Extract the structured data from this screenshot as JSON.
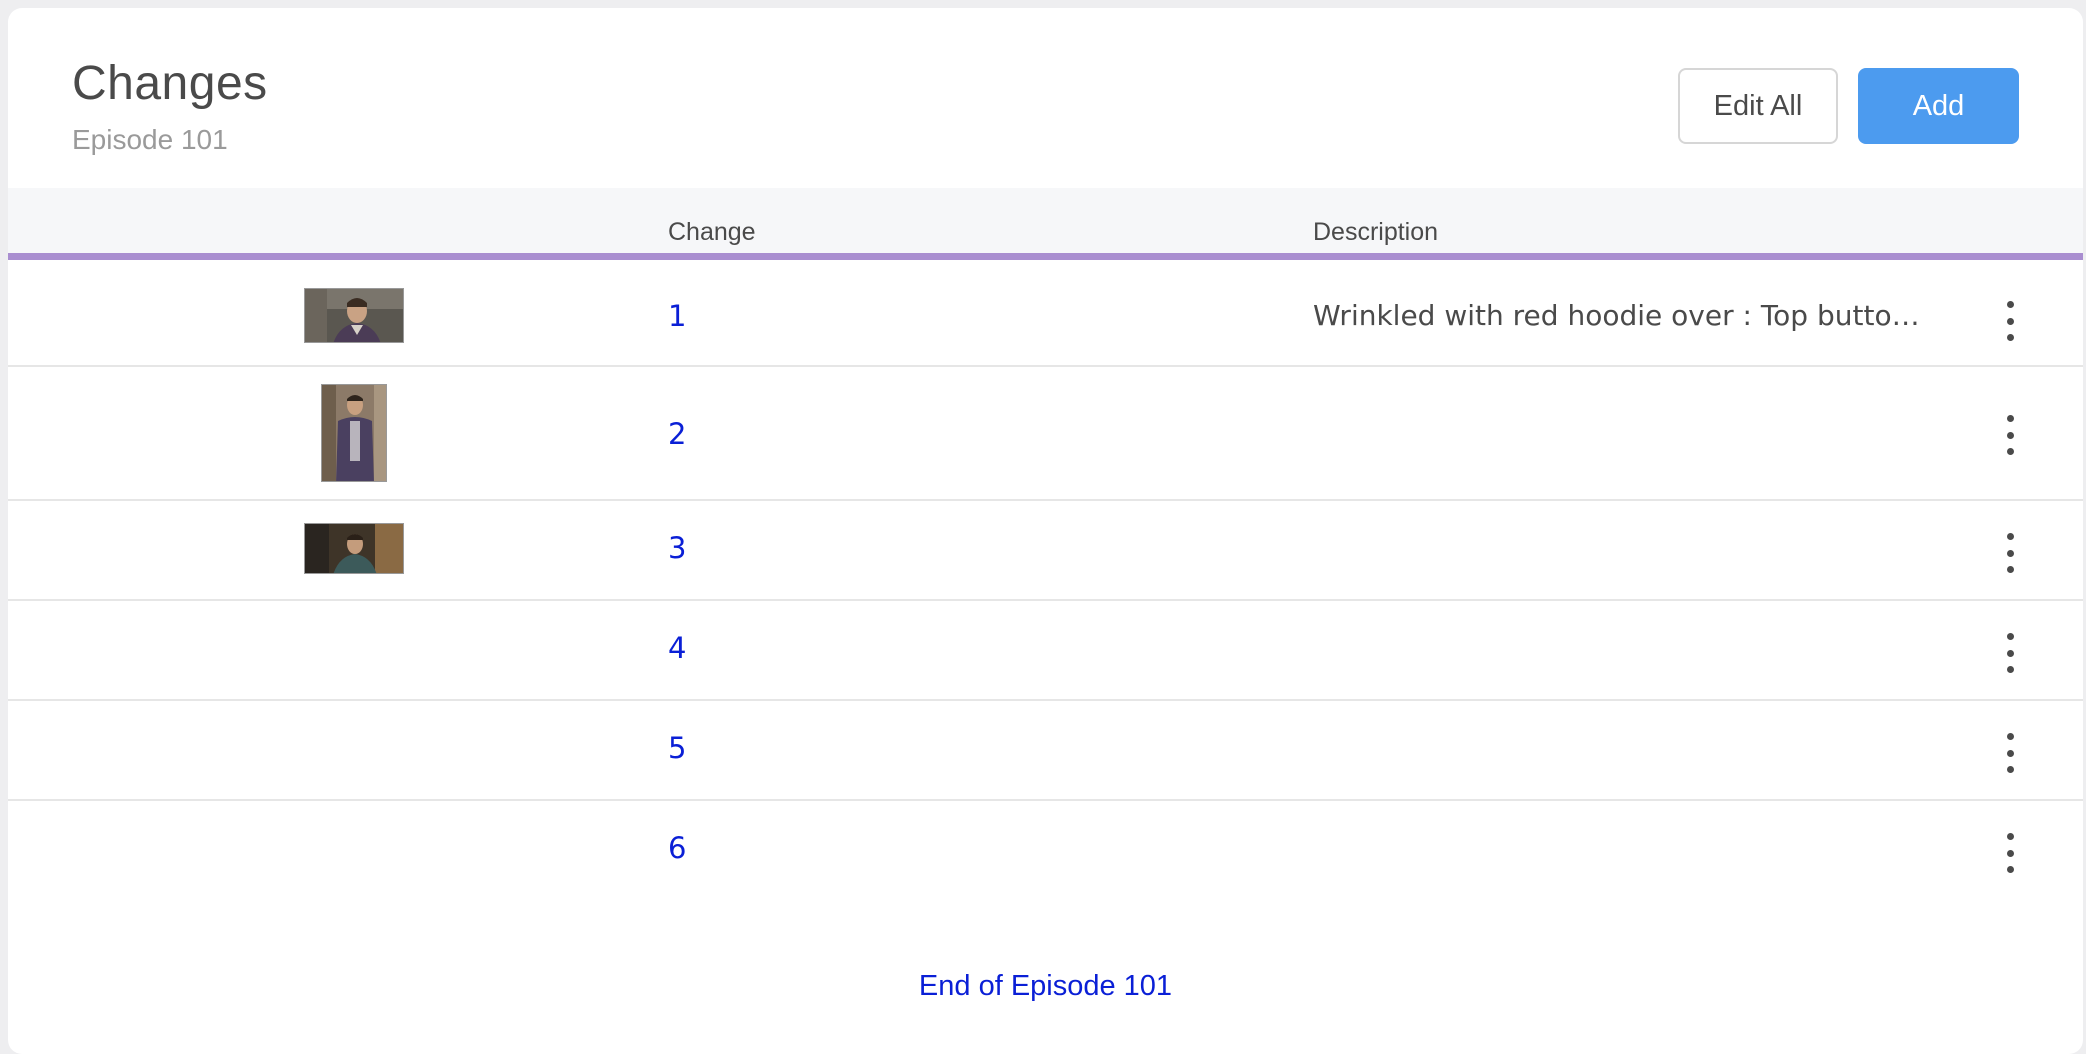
{
  "header": {
    "title": "Changes",
    "subtitle": "Episode 101",
    "edit_all_label": "Edit All",
    "add_label": "Add"
  },
  "table": {
    "columns": [
      "",
      "Change",
      "Description"
    ],
    "rows": [
      {
        "change": "1",
        "description": "Wrinkled with red hoodie over : Top button u...",
        "has_image": true
      },
      {
        "change": "2",
        "description": "",
        "has_image": true
      },
      {
        "change": "3",
        "description": "",
        "has_image": true
      },
      {
        "change": "4",
        "description": "",
        "has_image": false
      },
      {
        "change": "5",
        "description": "",
        "has_image": false
      },
      {
        "change": "6",
        "description": "",
        "has_image": false
      }
    ]
  },
  "footer": {
    "end_label": "End of Episode 101"
  },
  "colors": {
    "accent": "#4c9bef",
    "divider": "#a98ed0",
    "link": "#0a1fd6"
  },
  "icons": {
    "row_menu": "more-vertical-icon"
  }
}
